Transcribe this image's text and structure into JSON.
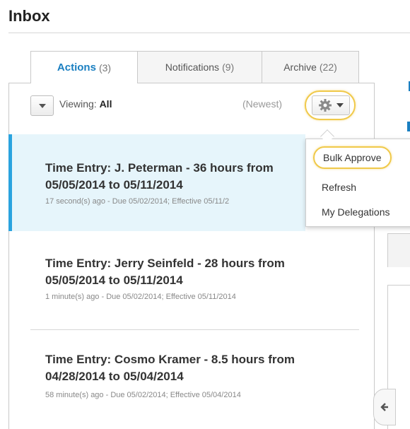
{
  "page": {
    "title": "Inbox"
  },
  "tabs": [
    {
      "label": "Actions",
      "count": "(3)"
    },
    {
      "label": "Notifications",
      "count": "(9)"
    },
    {
      "label": "Archive",
      "count": "(22)"
    }
  ],
  "toolbar": {
    "viewing_label": "Viewing:",
    "viewing_value": "All",
    "sort_label": "(Newest)"
  },
  "menu": {
    "items": [
      "Bulk Approve",
      "Refresh",
      "My Delegations"
    ]
  },
  "items": [
    {
      "title": "Time Entry: J. Peterman - 36 hours from 05/05/2014 to 05/11/2014",
      "meta": "17 second(s) ago - Due 05/02/2014; Effective 05/11/2"
    },
    {
      "title": "Time Entry: Jerry Seinfeld - 28 hours from 05/05/2014 to 05/11/2014",
      "meta": "1 minute(s) ago - Due 05/02/2014; Effective 05/11/2014"
    },
    {
      "title": "Time Entry: Cosmo Kramer - 8.5 hours from 04/28/2014 to 05/04/2014",
      "meta": "58 minute(s) ago - Due 05/02/2014; Effective 05/04/2014"
    }
  ],
  "colors": {
    "accent": "#1a7fc1",
    "highlight": "#f0c94a",
    "selected_bg": "#e6f5fb"
  }
}
